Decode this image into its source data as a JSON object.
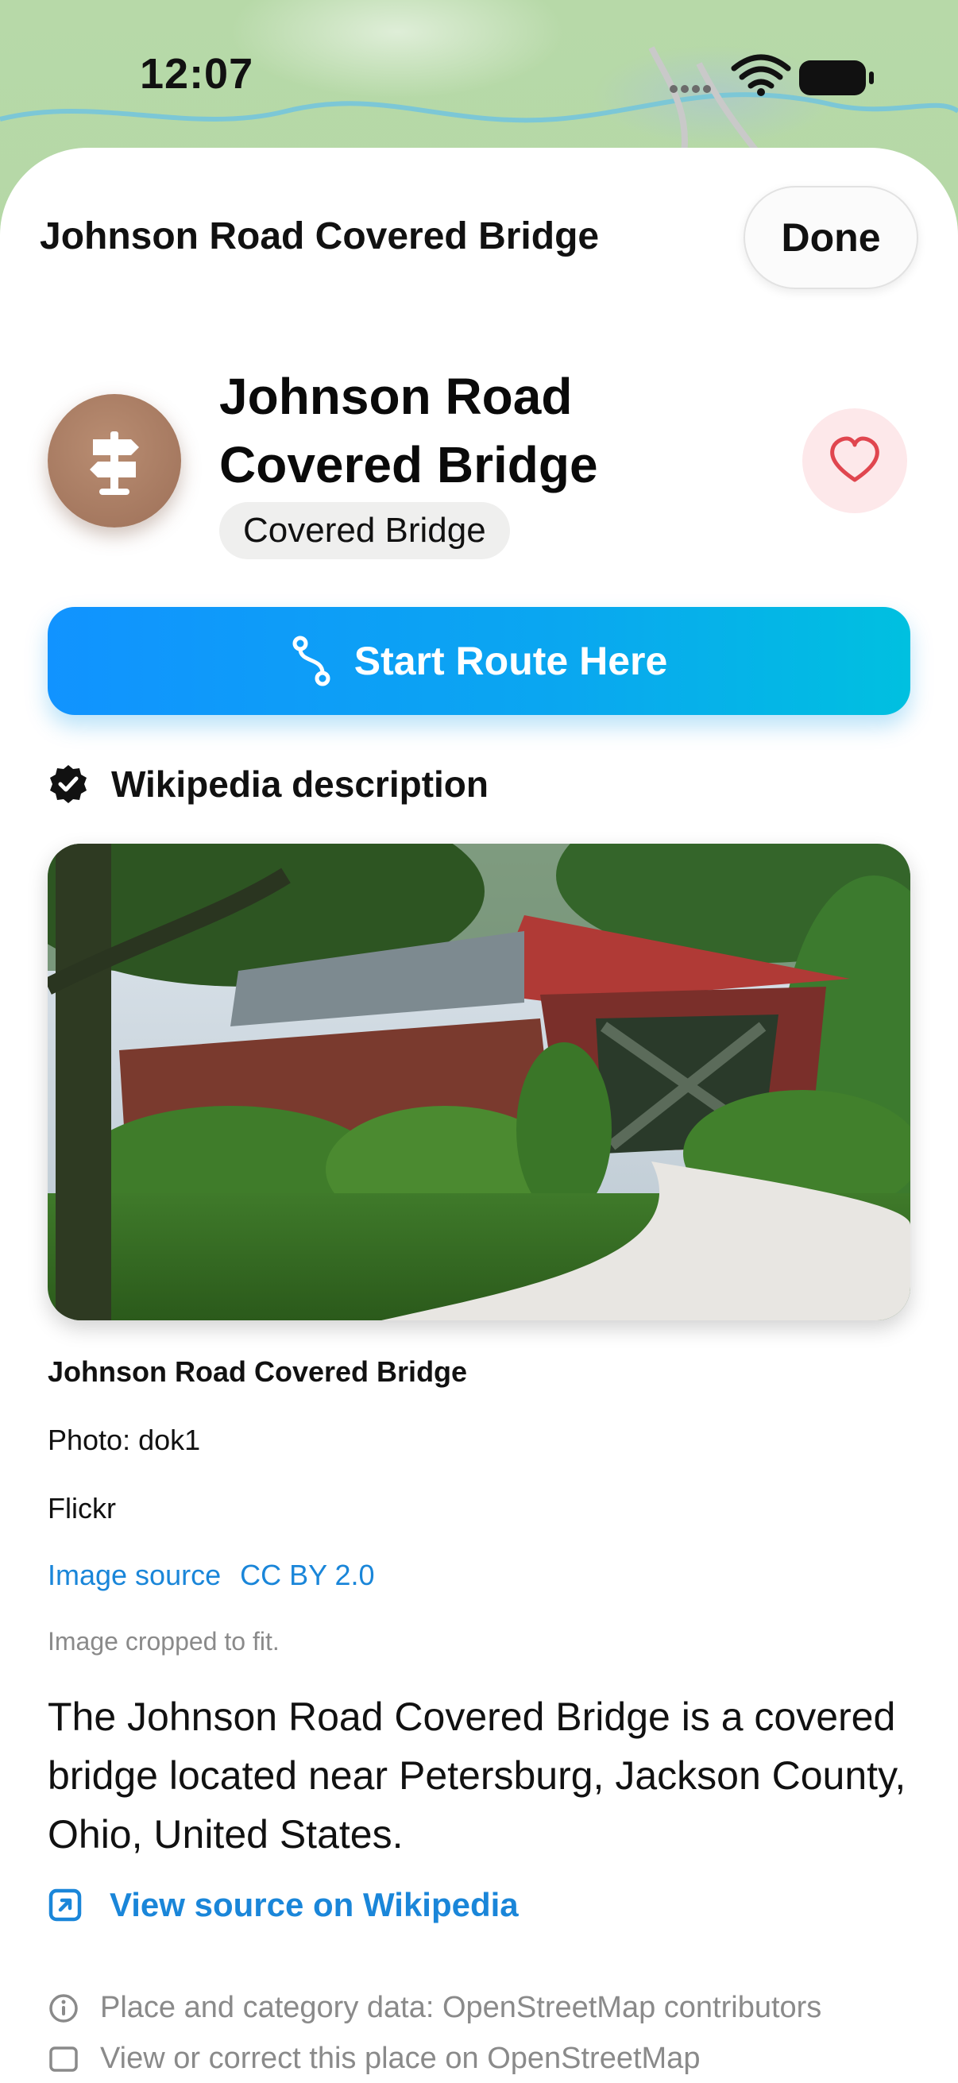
{
  "status_bar": {
    "time": "12:07"
  },
  "nav": {
    "title": "Johnson Road Covered Bridge",
    "done_label": "Done"
  },
  "place": {
    "name": "Johnson Road Covered Bridge",
    "category": "Covered Bridge",
    "icon": "signpost-icon",
    "icon_color": "#a67a62"
  },
  "route_button": {
    "label": "Start Route Here",
    "icon": "route-icon"
  },
  "wikipedia": {
    "heading": "Wikipedia description",
    "image_caption": "Johnson Road Covered Bridge",
    "photo_credit": "Photo: dok1",
    "photo_site": "Flickr",
    "image_source_label": "Image source",
    "license_label": "CC BY 2.0",
    "crop_note": "Image cropped to fit.",
    "description": "The Johnson Road Covered Bridge is a covered bridge located near Petersburg, Jackson County, Ohio, United States.",
    "view_source_label": "View source on Wikipedia"
  },
  "footer": {
    "osm_credit": "Place and category data: OpenStreetMap contributors",
    "osm_edit": "View or correct this place on OpenStreetMap"
  },
  "colors": {
    "accent": "#1a86d9",
    "route_start": "#1193ff",
    "route_end": "#00c0e0",
    "favorite": "#e0464f"
  }
}
